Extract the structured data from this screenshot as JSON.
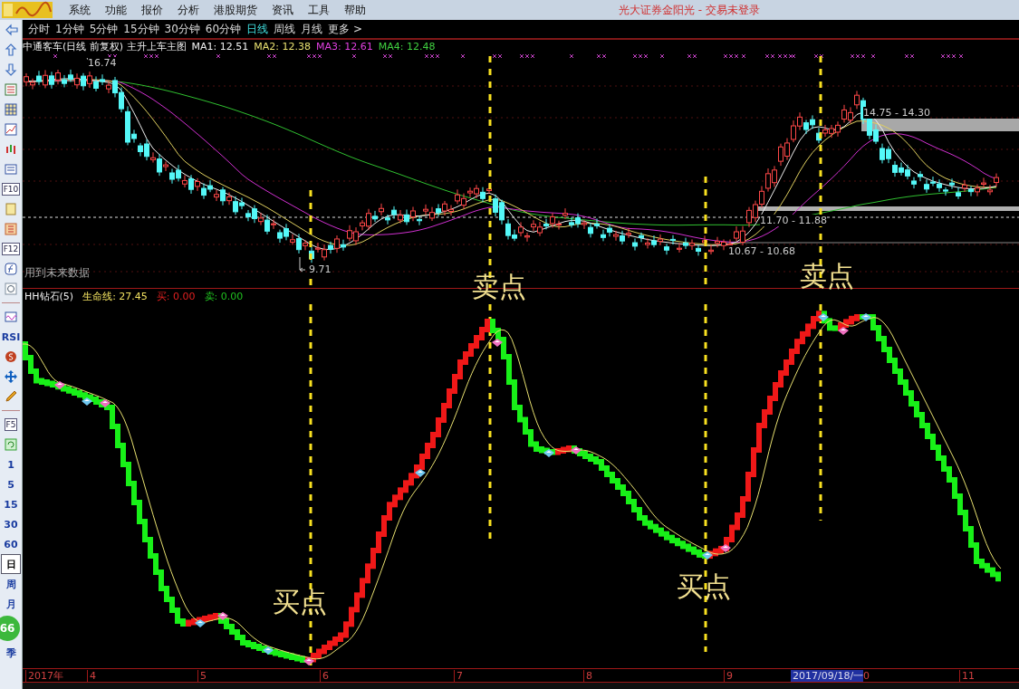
{
  "title_bar": {
    "menu": [
      "系统",
      "功能",
      "报价",
      "分析",
      "港股期货",
      "资讯",
      "工具",
      "帮助"
    ],
    "title": "光大证券金阳光 - 交易未登录"
  },
  "toolbar": {
    "items": [
      {
        "kind": "key",
        "text": "F10"
      },
      {
        "kind": "key",
        "text": "F12"
      },
      {
        "kind": "tool",
        "text": "RSI"
      },
      {
        "kind": "key",
        "text": "F5"
      },
      {
        "kind": "label",
        "text": "1",
        "selected": false
      },
      {
        "kind": "label",
        "text": "5",
        "selected": false
      },
      {
        "kind": "label",
        "text": "15",
        "selected": false
      },
      {
        "kind": "label",
        "text": "30",
        "selected": false
      },
      {
        "kind": "label",
        "text": "60",
        "selected": false
      },
      {
        "kind": "label",
        "text": "日",
        "selected": true
      },
      {
        "kind": "label",
        "text": "周",
        "selected": false
      },
      {
        "kind": "label",
        "text": "月",
        "selected": false
      },
      {
        "kind": "badge",
        "text": "66"
      },
      {
        "kind": "label",
        "text": "季",
        "selected": false
      }
    ]
  },
  "periods": [
    {
      "label": "分时",
      "selected": false
    },
    {
      "label": "1分钟",
      "selected": false
    },
    {
      "label": "5分钟",
      "selected": false
    },
    {
      "label": "15分钟",
      "selected": false
    },
    {
      "label": "30分钟",
      "selected": false
    },
    {
      "label": "60分钟",
      "selected": false
    },
    {
      "label": "日线",
      "selected": true
    },
    {
      "label": "周线",
      "selected": false
    },
    {
      "label": "月线",
      "selected": false
    },
    {
      "label": "更多 >",
      "selected": false
    }
  ],
  "main_chart": {
    "title": "中通客车(日线 前复权) 主升上车主图",
    "indicators": [
      {
        "text": "MA1: 12.51",
        "color": "#f0f0f0"
      },
      {
        "text": "MA2: 12.38",
        "color": "#e8e070"
      },
      {
        "text": "MA3: 12.61",
        "color": "#e040e0"
      },
      {
        "text": "MA4: 12.48",
        "color": "#40d040"
      }
    ],
    "labels": [
      "16.74",
      "9.71",
      "14.75 - 14.30",
      "11.70 - 11.88",
      "10.67 - 10.68"
    ],
    "note": "用到未来数据"
  },
  "indicator_panel": {
    "name": "HH钻石(5)",
    "values": [
      {
        "text": "生命线: 27.45",
        "color": "#f0e060"
      },
      {
        "text": "买: 0.00",
        "color": "#e02020"
      },
      {
        "text": "卖: 0.00",
        "color": "#20c020"
      }
    ]
  },
  "signals": [
    "卖点",
    "卖点",
    "买点",
    "买点"
  ],
  "axis": {
    "labels": [
      {
        "text": "2017年",
        "highlighted": false
      },
      {
        "text": "4",
        "highlighted": false
      },
      {
        "text": "5",
        "highlighted": false
      },
      {
        "text": "6",
        "highlighted": false
      },
      {
        "text": "7",
        "highlighted": false
      },
      {
        "text": "8",
        "highlighted": false
      },
      {
        "text": "9",
        "highlighted": false
      },
      {
        "text": "2017/09/18/一",
        "highlighted": true
      },
      {
        "text": "0",
        "highlighted": false
      },
      {
        "text": "11",
        "highlighted": false
      }
    ]
  }
}
